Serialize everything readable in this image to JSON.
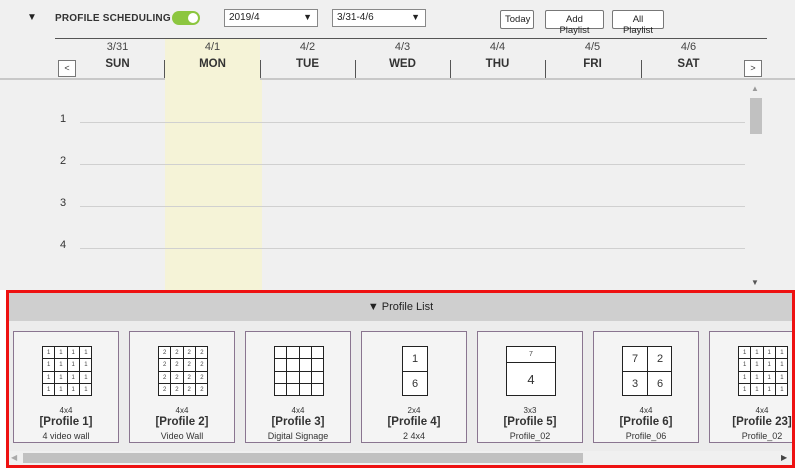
{
  "toolbar": {
    "collapse_icon": "▼",
    "title": "PROFILE SCHEDULING",
    "toggle_on": true,
    "toggle_color": "#8cc63f",
    "month_select": "2019/4",
    "week_select": "3/31-4/6",
    "caret": "▼",
    "today_label": "Today",
    "add_playlist_label": "Add Playlist",
    "all_playlist_label": "All Playlist"
  },
  "calendar": {
    "prev_label": "<",
    "next_label": ">",
    "days": [
      {
        "date": "3/31",
        "name": "SUN"
      },
      {
        "date": "4/1",
        "name": "MON"
      },
      {
        "date": "4/2",
        "name": "TUE"
      },
      {
        "date": "4/3",
        "name": "WED"
      },
      {
        "date": "4/4",
        "name": "THU"
      },
      {
        "date": "4/5",
        "name": "FRI"
      },
      {
        "date": "4/6",
        "name": "SAT"
      }
    ],
    "today_highlight_color": "#f5f3d7",
    "hours": [
      "1",
      "2",
      "3",
      "4"
    ]
  },
  "profile_list": {
    "header": "▼ Profile List",
    "border_color": "#e11111",
    "cards": [
      {
        "layout": "4x4",
        "name": "[Profile 1]",
        "sub": "4 video wall",
        "cell_label": "1"
      },
      {
        "layout": "4x4",
        "name": "[Profile 2]",
        "sub": "Video Wall",
        "cell_label": "2"
      },
      {
        "layout": "4x4",
        "name": "[Profile 3]",
        "sub": "Digital Signage",
        "cell_label": ""
      },
      {
        "layout": "2x4",
        "name": "[Profile 4]",
        "sub": "2 4x4",
        "labels": [
          "1",
          "6"
        ]
      },
      {
        "layout": "3x3",
        "name": "[Profile 5]",
        "sub": "Profile_02",
        "labels": [
          "7",
          "4"
        ]
      },
      {
        "layout": "4x4",
        "name": "[Profile 6]",
        "sub": "Profile_06",
        "labels": [
          "7",
          "2",
          "3",
          "6"
        ]
      },
      {
        "layout": "4x4",
        "name": "[Profile 23]",
        "sub": "Profile_02",
        "cell_label": "1"
      }
    ]
  }
}
